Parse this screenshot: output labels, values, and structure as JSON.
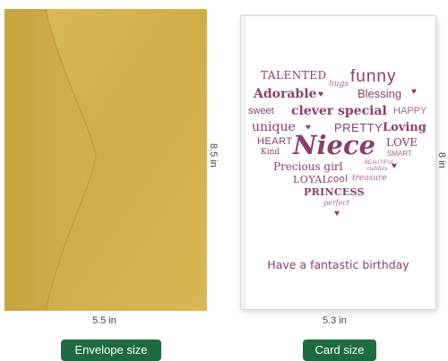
{
  "envelope": {
    "width_label": "5.5 in",
    "height_label": "8.5 in",
    "caption": "Envelope size",
    "color": "#d4b24c"
  },
  "card": {
    "width_label": "5.3 in",
    "height_label": "8 in",
    "caption": "Card size",
    "words": {
      "talented": "TALENTED",
      "hugs": "hugs",
      "funny": "funny",
      "adorable": "Adorable",
      "blessing": "Blessing",
      "sweet": "sweet",
      "clever": "clever",
      "special": "special",
      "happy": "HAPPY",
      "unique": "unique",
      "pretty": "PRETTY",
      "loving": "Loving",
      "heart": "HEART",
      "kind": "Kind",
      "niece": "Niece",
      "love": "LOVE",
      "smart": "SMART",
      "precious_girl": "Precious girl",
      "beautiful": "BEAUTIFUL",
      "cuddles": "cuddles",
      "loyal": "LOYAL",
      "cool": "cool",
      "treasure": "treasure",
      "princess": "PRINCESS",
      "perfect": "perfect"
    },
    "message": "Have a fantastic birthday",
    "accent_color": "#8c3d6a"
  },
  "caption_color": "#1f6b3f"
}
